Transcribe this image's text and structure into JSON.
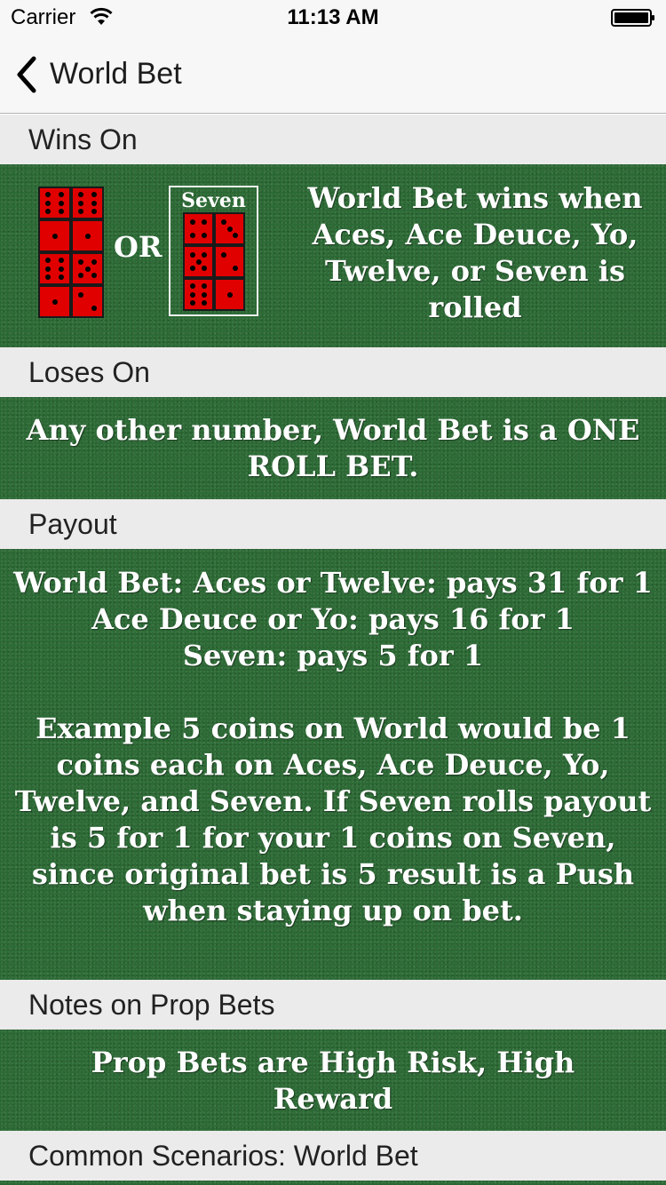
{
  "status_bar": {
    "carrier": "Carrier",
    "time": "11:13 AM"
  },
  "nav": {
    "back_label": "World Bet"
  },
  "sections": {
    "wins_on": {
      "header": "Wins On",
      "or_label": "OR",
      "seven_label": "Seven",
      "text": "World Bet wins when Aces, Ace Deuce, Yo, Twelve, or Seven is rolled"
    },
    "loses_on": {
      "header": "Loses On",
      "text": "Any other number, World Bet is a ONE ROLL BET."
    },
    "payout": {
      "header": "Payout",
      "lines": [
        "World Bet: Aces or Twelve: pays 31 for 1",
        "Ace Deuce or Yo: pays 16 for 1",
        "Seven: pays 5 for 1",
        "",
        "Example 5 coins on World would be 1 coins each on Aces, Ace Deuce, Yo, Twelve, and Seven. If Seven rolls payout is 5 for 1 for your 1 coins on Seven, since original bet is 5 result is a Push when staying up on bet."
      ]
    },
    "notes": {
      "header": "Notes on Prop Bets",
      "text": "Prop Bets are High Risk, High Reward"
    },
    "scenarios": {
      "header": "Common Scenarios: World Bet"
    }
  },
  "dice": {
    "left_pairs": [
      [
        6,
        6
      ],
      [
        1,
        1
      ],
      [
        6,
        5
      ],
      [
        1,
        2
      ]
    ],
    "seven_pairs": [
      [
        4,
        3
      ],
      [
        5,
        2
      ],
      [
        6,
        1
      ]
    ]
  },
  "colors": {
    "felt": "#2c6a35",
    "die": "#e00000",
    "header_bg": "#ebebeb"
  }
}
